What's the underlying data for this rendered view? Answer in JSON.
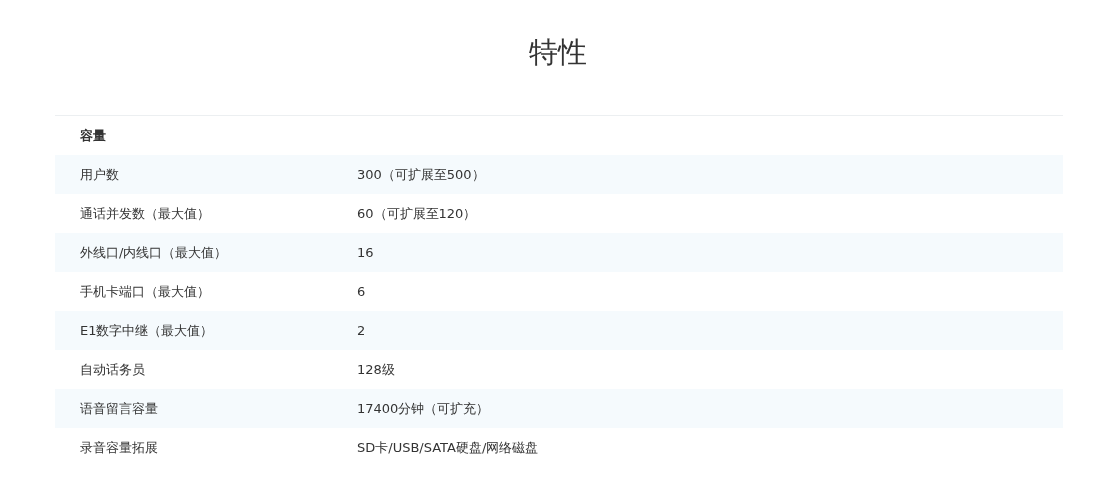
{
  "title": "特性",
  "section": "容量",
  "rows": [
    {
      "label": "用户数",
      "value": "300（可扩展至500）"
    },
    {
      "label": "通话并发数（最大值）",
      "value": "60（可扩展至120）"
    },
    {
      "label": "外线口/内线口（最大值）",
      "value": "16"
    },
    {
      "label": "手机卡端口（最大值）",
      "value": "6"
    },
    {
      "label": "E1数字中继（最大值）",
      "value": "2"
    },
    {
      "label": "自动话务员",
      "value": "128级"
    },
    {
      "label": "语音留言容量",
      "value": "17400分钟（可扩充）"
    },
    {
      "label": "录音容量拓展",
      "value": "SD卡/USB/SATA硬盘/网络磁盘"
    }
  ]
}
